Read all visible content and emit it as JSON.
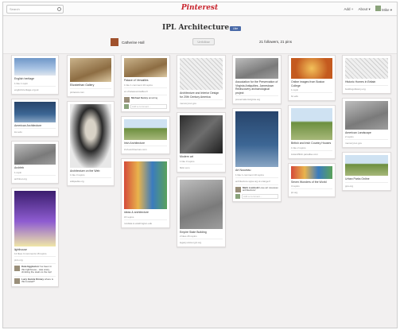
{
  "topbar": {
    "search_placeholder": "Search",
    "logo": "Pinterest",
    "nav": {
      "add": "Add +",
      "about": "About ▾",
      "user": "Mike ▾"
    }
  },
  "board": {
    "title": "IPL Architecture",
    "like_label": "Like",
    "owner": "Catherine Hall",
    "follow_label": "Unfollow",
    "stats": "21 followers, 21 pins"
  },
  "columns": [
    [
      {
        "img": "i-sky",
        "h": 22,
        "desc": "English heritage",
        "meta": "1 like   1 repin",
        "src": "english-heritage.org.uk",
        "img_icon": "sky-building-icon"
      },
      {
        "img": "i-blue",
        "h": 26,
        "desc": "American Architecture",
        "meta": "",
        "src": "loc.edu",
        "img_icon": "tower-icon"
      },
      {
        "img": "i-gray",
        "h": 26,
        "desc": "Archfeb",
        "meta": "1 repin",
        "src": "archinet.org",
        "img_icon": "arch-icon"
      },
      {
        "img": "i-purple",
        "h": 70,
        "desc": "lighthouse",
        "meta": "12 likes   3 comments   18 repins",
        "src": "pics.org",
        "img_icon": "lighthouse-icon",
        "comments": [
          {
            "author": "Kate Eggleston",
            "text": "I've been in this lighthouse - was scary climbing the stairs to the top!"
          },
          {
            "author": "Lucy Garcia Kinney",
            "text": "where is this located?"
          }
        ]
      }
    ],
    [
      {
        "img": "i-warm",
        "h": 30,
        "desc": "Elizabethan Gallery",
        "meta": "",
        "src": "pinterest.com",
        "img_icon": "gallery-icon"
      },
      {
        "img": "i-portrait",
        "h": 80,
        "desc": "Architecture on the Web",
        "meta": "1 like   3 repins",
        "src": "wikipedia.org",
        "img_icon": "portrait-icon"
      }
    ],
    [
      {
        "img": "i-warm",
        "h": 24,
        "desc": "Palace of Versailles",
        "meta": "1 like   1 comment   10 repins",
        "src": "en.chateauversailles.fr",
        "img_icon": "palace-icon",
        "comments": [
          {
            "author": "Michael Kenny",
            "text": "amazing"
          }
        ],
        "add_comment": "Add a comment..."
      },
      {
        "img": "i-green",
        "h": 26,
        "desc": "Irish Architecture",
        "meta": "",
        "src": "irish-architecture.com",
        "img_icon": "landscape-icon"
      },
      {
        "img": "i-colorful",
        "h": 60,
        "desc": "ideas & architecture",
        "meta": "15 repins",
        "src": "rundata.io.washington.edu",
        "img_icon": "database-art-icon"
      }
    ],
    [
      {
        "img": "i-sketch",
        "h": 40,
        "desc": "Architecture and Interior Design for 20th Century America",
        "meta": "",
        "src": "memory.loc.gov",
        "img_icon": "sketch-icon"
      },
      {
        "img": "i-dark",
        "h": 48,
        "desc": "Modern art",
        "meta": "1 like   3 repins",
        "src": "flickr.com",
        "img_icon": "modern-art-icon"
      },
      {
        "img": "i-gray",
        "h": 62,
        "desc": "Empire State Building",
        "meta": "2 likes   26 repins",
        "src": "legacy.www.nypl.org",
        "img_icon": "skyline-icon"
      }
    ],
    [
      {
        "img": "i-gray",
        "h": 26,
        "desc": "Association for the Preservation of Virginia Antiquities, Jamestown Rediscovery archaeological project",
        "meta": "",
        "src": "preservationvirginia.org",
        "img_icon": "book-icon"
      },
      {
        "img": "i-blue",
        "h": 70,
        "desc": "Art Nouveau",
        "meta": "1 like   1 comment   10 repins",
        "src": "architecture.sppa.org.ol.orange.fr",
        "img_icon": "door-icon",
        "comments": [
          {
            "author": "Mark Lombold",
            "text": "Love art nouveau architecture!"
          }
        ],
        "add_comment": "Add a comment..."
      }
    ],
    [
      {
        "img": "i-red",
        "h": 26,
        "desc": "Online images from Boston College",
        "meta": "1 repin",
        "src": "bc.edu",
        "img_icon": "ornament-icon"
      },
      {
        "img": "i-green",
        "h": 40,
        "desc": "British and Irish Country Houses",
        "meta": "1 like   2 repins",
        "src": "irelandflickr.paradise.com",
        "img_icon": "house-icon"
      },
      {
        "img": "i-colorful",
        "h": 16,
        "desc": "Seven Wonders of the World",
        "meta": "3 repins",
        "src": "ipl.org",
        "img_icon": "wonders-icon"
      }
    ],
    [
      {
        "img": "i-sketch",
        "h": 26,
        "desc": "Historic Homes in Britain",
        "meta": "",
        "src": "buildingshistory.org",
        "img_icon": "historic-house-icon"
      },
      {
        "img": "i-gray",
        "h": 36,
        "desc": "American Landscape",
        "meta": "2 repins",
        "src": "memory.loc.gov",
        "img_icon": "landscape-photo-icon"
      },
      {
        "img": "i-green",
        "h": 26,
        "desc": "Urban Parks Online",
        "meta": "",
        "src": "pps.org",
        "img_icon": "park-icon"
      }
    ]
  ]
}
